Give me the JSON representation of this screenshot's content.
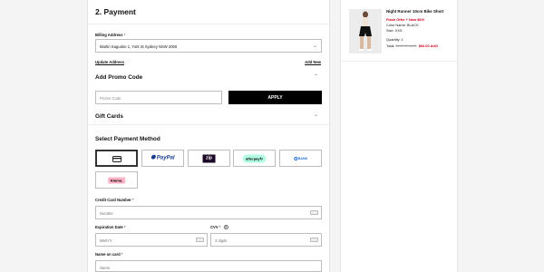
{
  "payment": {
    "title": "2. Payment",
    "billing_label": "Billing Address",
    "required_mark": "*",
    "billing_value": "Martin Sagudoe 1, York St Sydney NSW 2000",
    "update_address": "Update Address",
    "add_new": "Add New",
    "promo_title": "Add Promo Code",
    "promo_placeholder": "Promo Code",
    "apply_label": "APPLY",
    "gift_cards": "Gift Cards",
    "select_method": "Select Payment Method",
    "methods": [
      "card",
      "PayPal",
      "zip",
      "afterpay",
      "bank",
      "klarna"
    ],
    "paypal_text": "PayPal",
    "zip_text": "zip",
    "afterpay_text": "afterpay",
    "bank_text": "BANK",
    "klarna_text": "Klarna.",
    "cc_label": "Credit Card Number",
    "cc_placeholder": "Number",
    "exp_label": "Expiration Date",
    "exp_placeholder": "MM/YY",
    "cvv_label": "CVV",
    "cvv_help": "?",
    "cvv_placeholder": "3 digits",
    "name_label": "Name on card",
    "name_placeholder": "Name"
  },
  "summary": {
    "product_name": "Night Runner 10cm Bike Short",
    "flash_offer": "Flash Offer + Now $60!",
    "color": "Color Name: BLACK",
    "size": "Size: XXS",
    "quantity": "Quantity: 1",
    "total_label": "Total:",
    "original_price": "$100.00 AUD",
    "sale_price": "$60.00 AUD"
  },
  "colors": {
    "accent_red": "#d0021b",
    "button": "#000000"
  }
}
